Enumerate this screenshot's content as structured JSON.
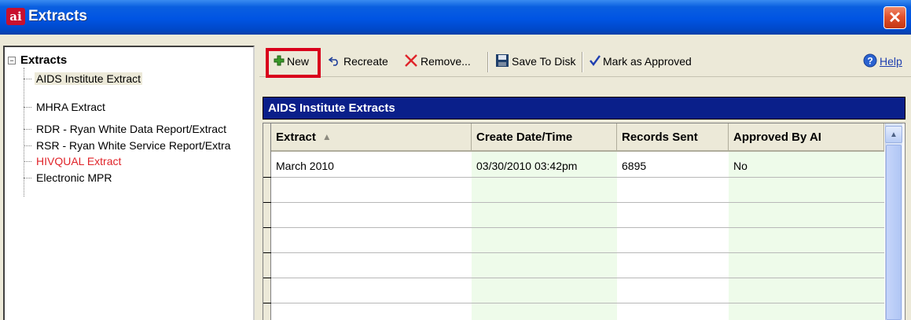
{
  "window": {
    "title": "Extracts",
    "logo_text": "ai",
    "close_glyph": "✕"
  },
  "tree": {
    "root_label": "Extracts",
    "expander_glyph": "−",
    "items": [
      {
        "label": "AIDS Institute Extract",
        "selected": true,
        "color": "#000000"
      },
      {
        "label": "MHRA Extract",
        "selected": false,
        "color": "#000000"
      },
      {
        "label": "RDR - Ryan White Data Report/Extract",
        "selected": false,
        "color": "#000000"
      },
      {
        "label": "RSR - Ryan White Service Report/Extra",
        "selected": false,
        "color": "#000000"
      },
      {
        "label": "HIVQUAL Extract",
        "selected": false,
        "color": "#e0242a"
      },
      {
        "label": "Electronic MPR",
        "selected": false,
        "color": "#000000"
      }
    ]
  },
  "toolbar": {
    "new_label": "New",
    "new_icon": "plus-icon",
    "recreate_label": "Recreate",
    "recreate_icon": "undo-arrow-icon",
    "remove_label": "Remove...",
    "remove_icon": "x-icon",
    "save_label": "Save To Disk",
    "save_icon": "floppy-disk-icon",
    "approve_label": "Mark as Approved",
    "approve_icon": "checkmark-icon",
    "help_label": "Help",
    "help_icon": "help-question-icon"
  },
  "grid": {
    "title": "AIDS Institute Extracts",
    "columns": [
      "Extract",
      "Create Date/Time",
      "Records Sent",
      "Approved By AI"
    ],
    "sort_glyph": "▲",
    "rows": [
      {
        "extract": "March 2010",
        "created": "03/30/2010 03:42pm",
        "records": "6895",
        "approved": "No"
      }
    ]
  },
  "colors": {
    "title_bar": "#0054e3",
    "grid_header": "#0a1f8a",
    "highlight": "#d9001b",
    "stripe": "#eefbea"
  }
}
